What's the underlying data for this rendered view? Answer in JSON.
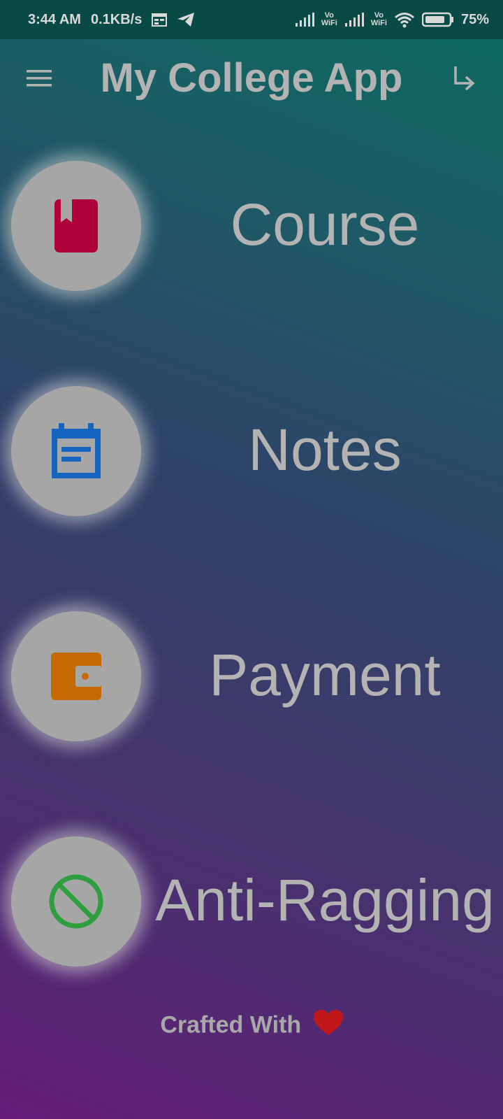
{
  "status_bar": {
    "time": "3:44 AM",
    "speed": "0.1KB/s",
    "volte1": "Vo",
    "wifi1": "WiFi",
    "volte2": "Vo",
    "wifi2": "WiFi",
    "battery": "75%"
  },
  "app_bar": {
    "title": "My College App",
    "menu_icon": "hamburger-menu-icon",
    "logout_icon": "logout-arrow-icon"
  },
  "menu": {
    "items": [
      {
        "label": "Course",
        "icon": "book-icon",
        "icon_color": "#b0003a"
      },
      {
        "label": "Notes",
        "icon": "calendar-note-icon",
        "icon_color": "#1565c0"
      },
      {
        "label": "Payment",
        "icon": "wallet-icon",
        "icon_color": "#c56a00"
      },
      {
        "label": "Anti-Ragging",
        "icon": "block-icon",
        "icon_color": "#2e9e3e"
      }
    ]
  },
  "footer": {
    "text": "Crafted With",
    "heart_icon": "heart-icon",
    "heart_color": "#c01818"
  }
}
